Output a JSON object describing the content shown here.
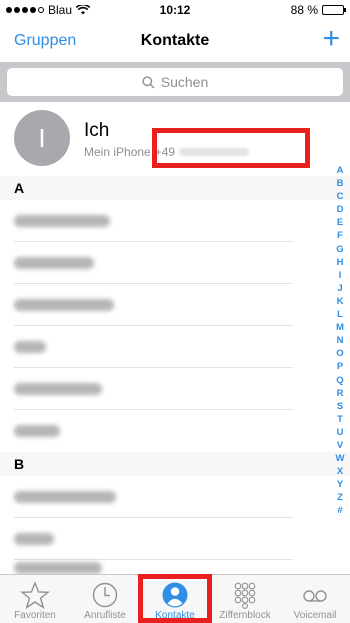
{
  "status": {
    "carrier": "Blau",
    "time": "10:12",
    "battery": "88 %",
    "battery_level": 0.88
  },
  "nav": {
    "left": "Gruppen",
    "title": "Kontakte",
    "add": "+"
  },
  "search": {
    "placeholder": "Suchen"
  },
  "me": {
    "initial": "I",
    "name": "Ich",
    "label": "Mein iPhone",
    "phone_prefix": "+49"
  },
  "sections": [
    {
      "letter": "A"
    },
    {
      "letter": "B"
    }
  ],
  "index_letters": [
    "A",
    "B",
    "C",
    "D",
    "E",
    "F",
    "G",
    "H",
    "I",
    "J",
    "K",
    "L",
    "M",
    "N",
    "O",
    "P",
    "Q",
    "R",
    "S",
    "T",
    "U",
    "V",
    "W",
    "X",
    "Y",
    "Z",
    "#"
  ],
  "tabs": [
    {
      "label": "Favoriten",
      "icon": "star-icon"
    },
    {
      "label": "Anrufliste",
      "icon": "clock-icon"
    },
    {
      "label": "Kontakte",
      "icon": "contacts-icon"
    },
    {
      "label": "Ziffernblock",
      "icon": "keypad-icon"
    },
    {
      "label": "Voicemail",
      "icon": "voicemail-icon"
    }
  ],
  "colors": {
    "accent": "#2f8ee5",
    "highlight": "#e8201f"
  }
}
